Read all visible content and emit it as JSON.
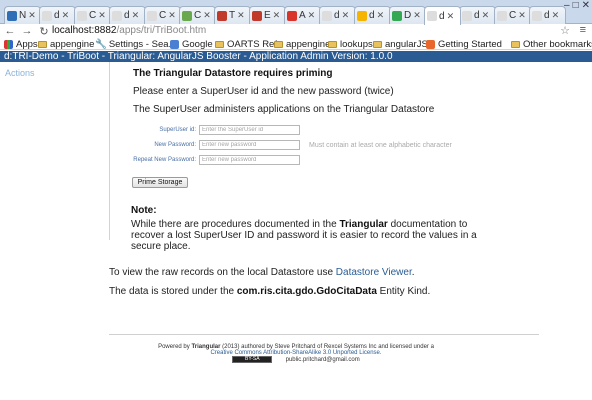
{
  "tabs": [
    {
      "title": "N",
      "favicon_color": "#2f6fb5"
    },
    {
      "title": "d",
      "favicon_color": "#dddddd"
    },
    {
      "title": "C",
      "favicon_color": "#dddddd"
    },
    {
      "title": "d",
      "favicon_color": "#dddddd"
    },
    {
      "title": "C",
      "favicon_color": "#dddddd"
    },
    {
      "title": "C",
      "favicon_color": "#6aa84f"
    },
    {
      "title": "T",
      "favicon_color": "#c0392b"
    },
    {
      "title": "E",
      "favicon_color": "#c0392b"
    },
    {
      "title": "A",
      "favicon_color": "#d9342b"
    },
    {
      "title": "d",
      "favicon_color": "#dddddd"
    },
    {
      "title": "d",
      "favicon_color": "#f4b400"
    },
    {
      "title": "D",
      "favicon_color": "#34a853"
    },
    {
      "title": "d",
      "favicon_color": "#dddddd"
    },
    {
      "title": "d",
      "favicon_color": "#dddddd"
    },
    {
      "title": "C",
      "favicon_color": "#dddddd"
    },
    {
      "title": "d",
      "favicon_color": "#dddddd"
    }
  ],
  "url": {
    "host": "localhost:8882",
    "path": "/apps/tri/TriBoot.htm"
  },
  "bookmarks": {
    "apps": "Apps",
    "items": [
      "appengine",
      "Settings - Sea...",
      "Google",
      "OARTS Refs",
      "appengine",
      "lookups",
      "angularJS",
      "Getting Started"
    ],
    "other": "Other bookmarks"
  },
  "app_title": "d:TRI-Demo - TriBoot - Triangular: AngularJS Booster - Application Admin Version: 1.0.0",
  "sidebar": {
    "actions_label": "Actions"
  },
  "main": {
    "heading": "The Triangular Datastore requires priming",
    "instruction": "Please enter a SuperUser id and the new password (twice)",
    "description": "The SuperUser administers applications on the Triangular Datastore",
    "form": {
      "superuser_label": "SuperUser id:",
      "superuser_placeholder": "Enter the SuperUser id",
      "new_password_label": "New Password:",
      "new_password_placeholder": "Enter new password",
      "repeat_password_label": "Repeat New Password:",
      "repeat_password_placeholder": "Enter new password",
      "password_hint": "Must contain at least one alphabetic character",
      "submit_label": "Prime Storage"
    },
    "note": {
      "title": "Note:",
      "text_before": "While there are procedures documented in the ",
      "text_bold": "Triangular",
      "text_after": " documentation to recover a lost SuperUser ID and password it is easier to record the values in a secure place."
    }
  },
  "datastore": {
    "text_before": "To view the raw records on the local Datastore use ",
    "link": "Datastore Viewer",
    "text_after": "."
  },
  "storage": {
    "text_before": "The data is stored under the ",
    "entity": "com.ris.cita.gdo.GdoCitaData",
    "text_after": " Entity Kind."
  },
  "footer": {
    "line1_before": "Powered by ",
    "product": "Triangular",
    "line1_after": " (2013) authored by Steve Pritchard of Rexcel Systems Inc and licensed under a",
    "license_link": "Creative Commons Attribution-ShareAlike 3.0 Unported License.",
    "badge": "BY-SA",
    "user": "public.pritchard@gmail.com"
  },
  "colors": {
    "header_bg": "#2a5c93",
    "link": "#2a5c93",
    "sidebar_link": "#8cb3d9",
    "form_label": "#4a6fa5"
  }
}
